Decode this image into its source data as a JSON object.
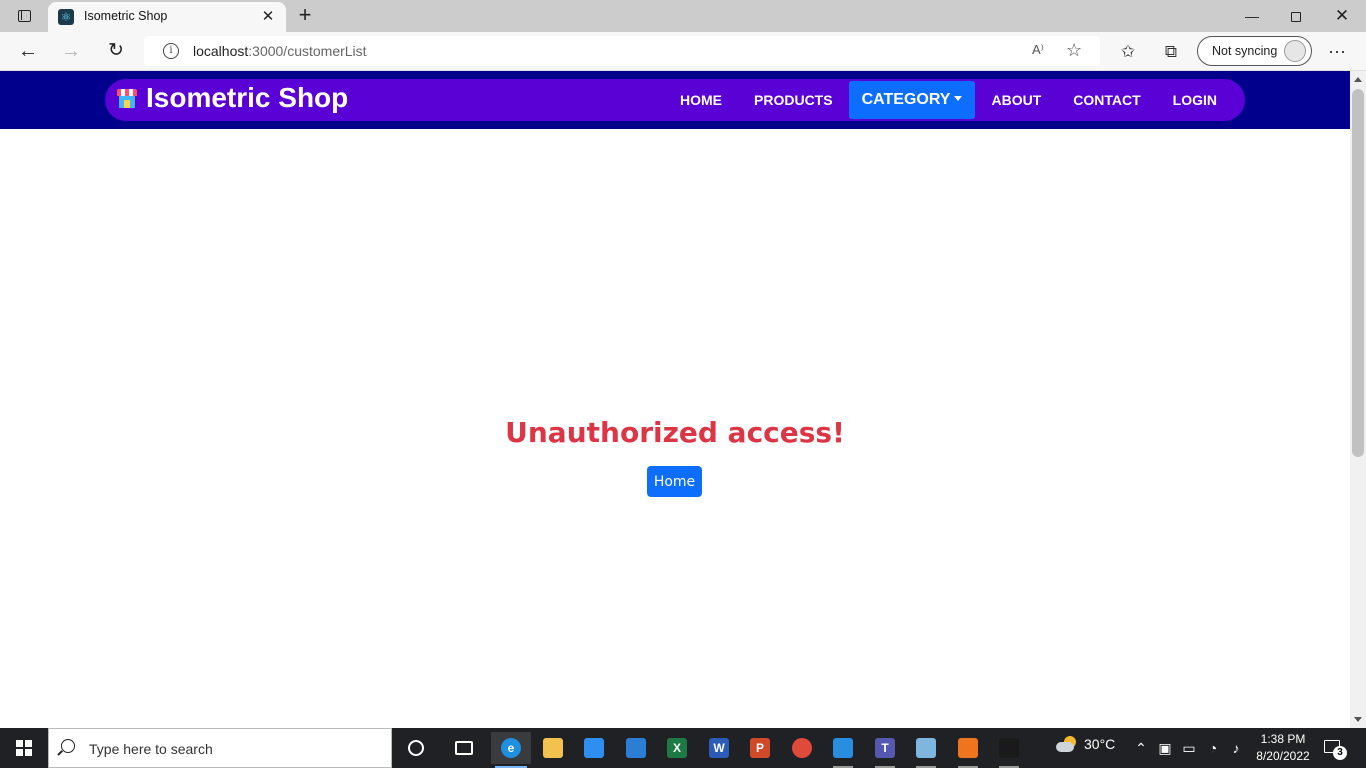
{
  "browser": {
    "tab_title": "Isometric Shop",
    "new_tab_symbol": "+",
    "close_symbol": "✕",
    "url_host": "localhost",
    "url_rest": ":3000/customerList",
    "read_aloud_label": "A⁾",
    "profile_label": "Not syncing",
    "more_symbol": "⋯"
  },
  "site": {
    "brand": "Isometric Shop",
    "nav": [
      {
        "label": "HOME"
      },
      {
        "label": "PRODUCTS"
      },
      {
        "label": "CATEGORY",
        "active": true,
        "dropdown": true
      },
      {
        "label": "ABOUT"
      },
      {
        "label": "CONTACT"
      },
      {
        "label": "LOGIN"
      }
    ],
    "message": "Unauthorized access!",
    "home_button": "Home"
  },
  "taskbar": {
    "search_placeholder": "Type here to search",
    "apps": [
      {
        "name": "edge",
        "letter": "e",
        "color": "#1f8fe0",
        "state": "active"
      },
      {
        "name": "file-explorer",
        "letter": "",
        "color": "#f2c14e",
        "state": ""
      },
      {
        "name": "microsoft-store",
        "letter": "",
        "color": "#2f8ff0",
        "state": ""
      },
      {
        "name": "mail",
        "letter": "",
        "color": "#2a7fd4",
        "state": ""
      },
      {
        "name": "excel",
        "letter": "X",
        "color": "#1d7a43",
        "state": ""
      },
      {
        "name": "word",
        "letter": "W",
        "color": "#2b5cb8",
        "state": ""
      },
      {
        "name": "powerpoint",
        "letter": "P",
        "color": "#d04a2a",
        "state": ""
      },
      {
        "name": "chrome",
        "letter": "",
        "color": "#e04a3a",
        "state": ""
      },
      {
        "name": "vscode",
        "letter": "",
        "color": "#2a8ee0",
        "state": "running"
      },
      {
        "name": "teams",
        "letter": "T",
        "color": "#5558af",
        "state": "running"
      },
      {
        "name": "app-notepad",
        "letter": "",
        "color": "#7fb6e0",
        "state": "running"
      },
      {
        "name": "xampp",
        "letter": "",
        "color": "#f0731d",
        "state": "running"
      },
      {
        "name": "terminal",
        "letter": "",
        "color": "#1a1a1a",
        "state": "running"
      }
    ],
    "temperature": "30°C",
    "time": "1:38 PM",
    "date": "8/20/2022",
    "notification_count": "3"
  },
  "colors": {
    "topbar": "#01008d",
    "navpill": "#5a01d5",
    "active_nav": "#0d6efd",
    "message": "#dc3545",
    "button": "#0d6efd"
  }
}
